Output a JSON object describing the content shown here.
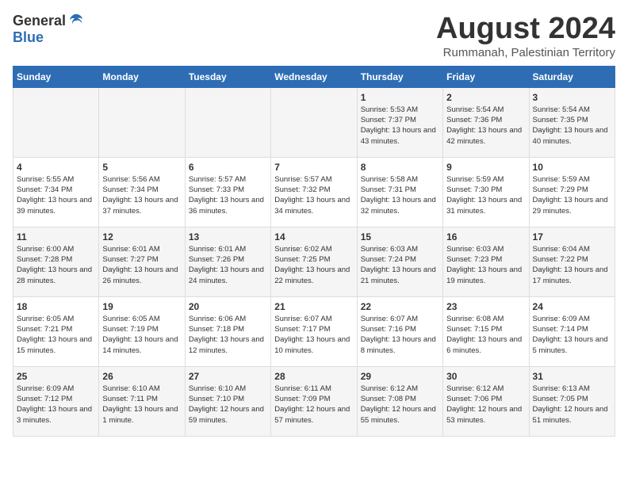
{
  "logo": {
    "general": "General",
    "blue": "Blue"
  },
  "title": "August 2024",
  "subtitle": "Rummanah, Palestinian Territory",
  "days_of_week": [
    "Sunday",
    "Monday",
    "Tuesday",
    "Wednesday",
    "Thursday",
    "Friday",
    "Saturday"
  ],
  "weeks": [
    [
      {
        "day": "",
        "info": ""
      },
      {
        "day": "",
        "info": ""
      },
      {
        "day": "",
        "info": ""
      },
      {
        "day": "",
        "info": ""
      },
      {
        "day": "1",
        "info": "Sunrise: 5:53 AM\nSunset: 7:37 PM\nDaylight: 13 hours and 43 minutes."
      },
      {
        "day": "2",
        "info": "Sunrise: 5:54 AM\nSunset: 7:36 PM\nDaylight: 13 hours and 42 minutes."
      },
      {
        "day": "3",
        "info": "Sunrise: 5:54 AM\nSunset: 7:35 PM\nDaylight: 13 hours and 40 minutes."
      }
    ],
    [
      {
        "day": "4",
        "info": "Sunrise: 5:55 AM\nSunset: 7:34 PM\nDaylight: 13 hours and 39 minutes."
      },
      {
        "day": "5",
        "info": "Sunrise: 5:56 AM\nSunset: 7:34 PM\nDaylight: 13 hours and 37 minutes."
      },
      {
        "day": "6",
        "info": "Sunrise: 5:57 AM\nSunset: 7:33 PM\nDaylight: 13 hours and 36 minutes."
      },
      {
        "day": "7",
        "info": "Sunrise: 5:57 AM\nSunset: 7:32 PM\nDaylight: 13 hours and 34 minutes."
      },
      {
        "day": "8",
        "info": "Sunrise: 5:58 AM\nSunset: 7:31 PM\nDaylight: 13 hours and 32 minutes."
      },
      {
        "day": "9",
        "info": "Sunrise: 5:59 AM\nSunset: 7:30 PM\nDaylight: 13 hours and 31 minutes."
      },
      {
        "day": "10",
        "info": "Sunrise: 5:59 AM\nSunset: 7:29 PM\nDaylight: 13 hours and 29 minutes."
      }
    ],
    [
      {
        "day": "11",
        "info": "Sunrise: 6:00 AM\nSunset: 7:28 PM\nDaylight: 13 hours and 28 minutes."
      },
      {
        "day": "12",
        "info": "Sunrise: 6:01 AM\nSunset: 7:27 PM\nDaylight: 13 hours and 26 minutes."
      },
      {
        "day": "13",
        "info": "Sunrise: 6:01 AM\nSunset: 7:26 PM\nDaylight: 13 hours and 24 minutes."
      },
      {
        "day": "14",
        "info": "Sunrise: 6:02 AM\nSunset: 7:25 PM\nDaylight: 13 hours and 22 minutes."
      },
      {
        "day": "15",
        "info": "Sunrise: 6:03 AM\nSunset: 7:24 PM\nDaylight: 13 hours and 21 minutes."
      },
      {
        "day": "16",
        "info": "Sunrise: 6:03 AM\nSunset: 7:23 PM\nDaylight: 13 hours and 19 minutes."
      },
      {
        "day": "17",
        "info": "Sunrise: 6:04 AM\nSunset: 7:22 PM\nDaylight: 13 hours and 17 minutes."
      }
    ],
    [
      {
        "day": "18",
        "info": "Sunrise: 6:05 AM\nSunset: 7:21 PM\nDaylight: 13 hours and 15 minutes."
      },
      {
        "day": "19",
        "info": "Sunrise: 6:05 AM\nSunset: 7:19 PM\nDaylight: 13 hours and 14 minutes."
      },
      {
        "day": "20",
        "info": "Sunrise: 6:06 AM\nSunset: 7:18 PM\nDaylight: 13 hours and 12 minutes."
      },
      {
        "day": "21",
        "info": "Sunrise: 6:07 AM\nSunset: 7:17 PM\nDaylight: 13 hours and 10 minutes."
      },
      {
        "day": "22",
        "info": "Sunrise: 6:07 AM\nSunset: 7:16 PM\nDaylight: 13 hours and 8 minutes."
      },
      {
        "day": "23",
        "info": "Sunrise: 6:08 AM\nSunset: 7:15 PM\nDaylight: 13 hours and 6 minutes."
      },
      {
        "day": "24",
        "info": "Sunrise: 6:09 AM\nSunset: 7:14 PM\nDaylight: 13 hours and 5 minutes."
      }
    ],
    [
      {
        "day": "25",
        "info": "Sunrise: 6:09 AM\nSunset: 7:12 PM\nDaylight: 13 hours and 3 minutes."
      },
      {
        "day": "26",
        "info": "Sunrise: 6:10 AM\nSunset: 7:11 PM\nDaylight: 13 hours and 1 minute."
      },
      {
        "day": "27",
        "info": "Sunrise: 6:10 AM\nSunset: 7:10 PM\nDaylight: 12 hours and 59 minutes."
      },
      {
        "day": "28",
        "info": "Sunrise: 6:11 AM\nSunset: 7:09 PM\nDaylight: 12 hours and 57 minutes."
      },
      {
        "day": "29",
        "info": "Sunrise: 6:12 AM\nSunset: 7:08 PM\nDaylight: 12 hours and 55 minutes."
      },
      {
        "day": "30",
        "info": "Sunrise: 6:12 AM\nSunset: 7:06 PM\nDaylight: 12 hours and 53 minutes."
      },
      {
        "day": "31",
        "info": "Sunrise: 6:13 AM\nSunset: 7:05 PM\nDaylight: 12 hours and 51 minutes."
      }
    ]
  ]
}
